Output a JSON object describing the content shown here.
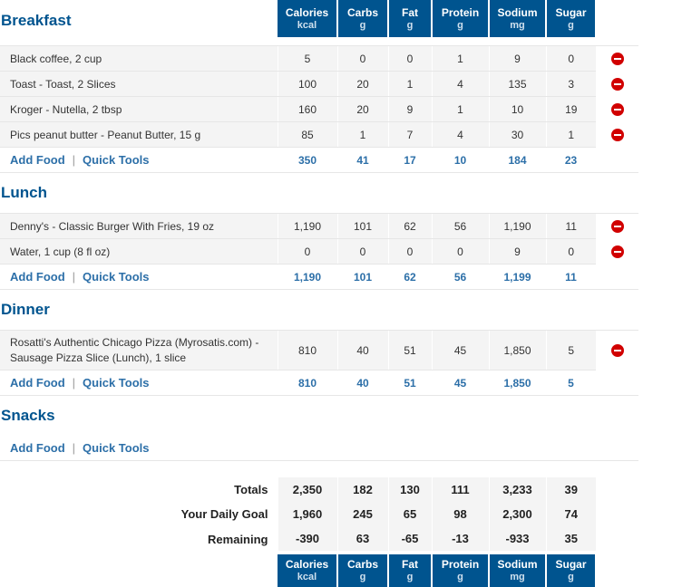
{
  "columns": [
    {
      "name": "Calories",
      "unit": "kcal"
    },
    {
      "name": "Carbs",
      "unit": "g"
    },
    {
      "name": "Fat",
      "unit": "g"
    },
    {
      "name": "Protein",
      "unit": "g"
    },
    {
      "name": "Sodium",
      "unit": "mg"
    },
    {
      "name": "Sugar",
      "unit": "g"
    }
  ],
  "links": {
    "add_food": "Add Food",
    "separator": "|",
    "quick_tools": "Quick Tools"
  },
  "meals": [
    {
      "title": "Breakfast",
      "foods": [
        {
          "name": "Black coffee, 2 cup",
          "values": [
            "5",
            "0",
            "0",
            "1",
            "9",
            "0"
          ]
        },
        {
          "name": "Toast - Toast, 2 Slices",
          "values": [
            "100",
            "20",
            "1",
            "4",
            "135",
            "3"
          ]
        },
        {
          "name": "Kroger - Nutella, 2 tbsp",
          "values": [
            "160",
            "20",
            "9",
            "1",
            "10",
            "19"
          ]
        },
        {
          "name": "Pics peanut butter - Peanut Butter, 15 g",
          "values": [
            "85",
            "1",
            "7",
            "4",
            "30",
            "1"
          ]
        }
      ],
      "totals": [
        "350",
        "41",
        "17",
        "10",
        "184",
        "23"
      ]
    },
    {
      "title": "Lunch",
      "foods": [
        {
          "name": "Denny's - Classic Burger With Fries, 19 oz",
          "values": [
            "1,190",
            "101",
            "62",
            "56",
            "1,190",
            "11"
          ]
        },
        {
          "name": "Water, 1 cup (8 fl oz)",
          "values": [
            "0",
            "0",
            "0",
            "0",
            "9",
            "0"
          ]
        }
      ],
      "totals": [
        "1,190",
        "101",
        "62",
        "56",
        "1,199",
        "11"
      ]
    },
    {
      "title": "Dinner",
      "foods": [
        {
          "name": "Rosatti's Authentic Chicago Pizza (Myrosatis.com) - Sausage Pizza Slice (Lunch), 1 slice",
          "values": [
            "810",
            "40",
            "51",
            "45",
            "1,850",
            "5"
          ]
        }
      ],
      "totals": [
        "810",
        "40",
        "51",
        "45",
        "1,850",
        "5"
      ]
    },
    {
      "title": "Snacks",
      "foods": [],
      "totals": [
        "",
        "",
        "",
        "",
        "",
        ""
      ]
    }
  ],
  "summary": {
    "totals": {
      "label": "Totals",
      "values": [
        "2,350",
        "182",
        "130",
        "111",
        "3,233",
        "39"
      ]
    },
    "goal": {
      "label": "Your Daily Goal",
      "values": [
        "1,960",
        "245",
        "65",
        "98",
        "2,300",
        "74"
      ]
    },
    "remaining": {
      "label": "Remaining",
      "values": [
        "-390",
        "63",
        "-65",
        "-13",
        "-933",
        "35"
      ]
    }
  },
  "colors": {
    "header_bg": "#00548f",
    "link": "#2c6fa8",
    "negative": "#d10000",
    "positive": "#2a8a2a",
    "delete_icon": "#d10000"
  },
  "icons": {
    "delete": "remove-circle-icon"
  }
}
